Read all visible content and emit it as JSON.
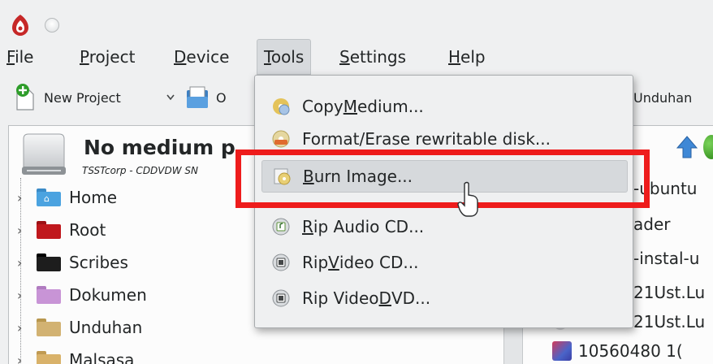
{
  "menubar": {
    "file": {
      "mn": "F",
      "rest": "ile"
    },
    "project": {
      "mn": "P",
      "rest": "roject"
    },
    "device": {
      "mn": "D",
      "rest": "evice"
    },
    "tools": {
      "mn": "T",
      "rest": "ools"
    },
    "settings": {
      "mn": "S",
      "rest": "ettings"
    },
    "help": {
      "mn": "H",
      "rest": "elp"
    }
  },
  "toolbar": {
    "new_project": "New Project",
    "open_partial": "O",
    "right_partial": "Unduhan"
  },
  "medium": {
    "title": "No medium p",
    "subtitle": "TSSTcorp - CDDVDW SN"
  },
  "tree": {
    "items": [
      {
        "label": "Home",
        "icon": "home-folder-icon",
        "color": "#4ba3e0"
      },
      {
        "label": "Root",
        "icon": "root-folder-icon",
        "color": "#c0181d"
      },
      {
        "label": "Scribes",
        "icon": "black-folder-icon",
        "color": "#1d1d1d"
      },
      {
        "label": "Dokumen",
        "icon": "documents-folder-icon",
        "color": "#c894d6"
      },
      {
        "label": "Unduhan",
        "icon": "downloads-folder-icon",
        "color": "#d2b272"
      },
      {
        "label": "Malsasa",
        "icon": "user-folder-icon",
        "color": "#d9b26a"
      }
    ]
  },
  "files": {
    "rows": [
      "-ubuntu",
      "ader",
      "-instal-u",
      "21Ust.Lu",
      "21Ust.Lu",
      "10560480 1("
    ]
  },
  "tools_menu": {
    "items": [
      {
        "pre": "Copy ",
        "mn": "M",
        "post": "edium...",
        "icon": "copy-medium-icon"
      },
      {
        "pre": "Format/Erase rewritable disk...",
        "mn": "",
        "post": "",
        "icon": "format-disk-icon"
      },
      {
        "pre": "",
        "mn": "B",
        "post": "urn Image...",
        "icon": "burn-image-icon"
      },
      {
        "pre": "",
        "mn": "R",
        "post": "ip Audio CD...",
        "icon": "rip-audio-icon"
      },
      {
        "pre": "Rip ",
        "mn": "V",
        "post": "ideo CD...",
        "icon": "rip-video-cd-icon"
      },
      {
        "pre": "Rip Video ",
        "mn": "D",
        "post": "VD...",
        "icon": "rip-video-dvd-icon"
      }
    ]
  },
  "colors": {
    "highlight": "#ee1c1c",
    "menu_bg": "#eff0f1",
    "hover_bg": "#d6d9dc"
  }
}
